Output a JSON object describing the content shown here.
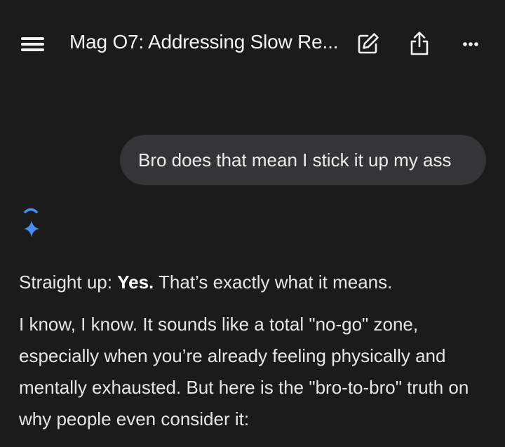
{
  "header": {
    "title": "Mag O7: Addressing Slow Re...",
    "menu_icon": "hamburger-menu-icon",
    "edit_icon": "edit-icon",
    "share_icon": "share-icon",
    "more_icon": "more-options-icon"
  },
  "conversation": {
    "user_message": "Bro does that mean I stick it up my ass",
    "assistant_icon": "sparkle-icon",
    "response": {
      "line1_prefix": "Straight up: ",
      "line1_bold": "Yes.",
      "line1_suffix": " That’s exactly what it means.",
      "paragraph2": "I know, I know. It sounds like a total \"no-go\" zone, especially when you’re already feeling physically and mentally exhausted. But here is the \"bro-to-bro\" truth on why people even consider it:"
    }
  },
  "colors": {
    "background": "#1b1b1b",
    "bubble": "#333537",
    "text": "#e6e6e6",
    "accent_blue": "#4a8cf7"
  }
}
